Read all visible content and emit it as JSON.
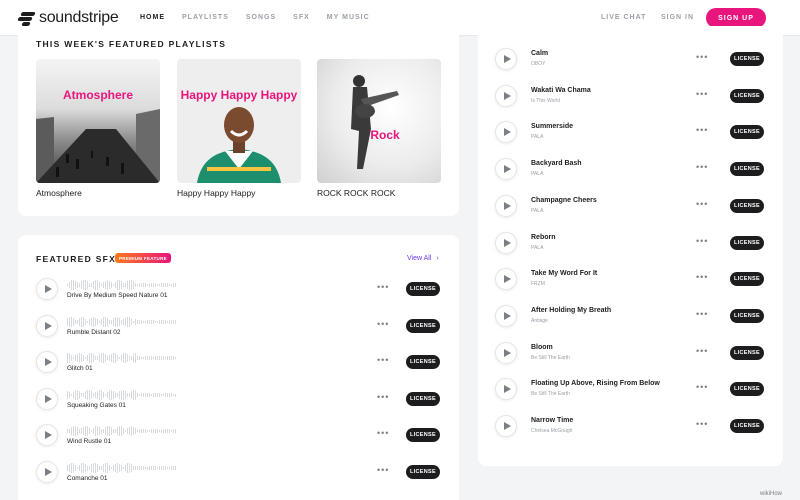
{
  "header": {
    "logo": "soundstripe",
    "nav": [
      "HOME",
      "PLAYLISTS",
      "SONGS",
      "SFX",
      "MY MUSIC"
    ],
    "live_chat": "LIVE CHAT",
    "sign_in": "SIGN IN",
    "sign_up": "SIGN UP",
    "accent": "#e8157d"
  },
  "playlists": {
    "title": "THIS WEEK'S FEATURED PLAYLISTS",
    "items": [
      {
        "overlay": "Atmosphere",
        "caption": "Atmosphere",
        "overlay_color": "#e8157d"
      },
      {
        "overlay": "Happy Happy Happy",
        "caption": "Happy Happy Happy",
        "overlay_color": "#e8157d"
      },
      {
        "overlay": "Rock",
        "caption": "ROCK ROCK ROCK",
        "overlay_color": "#e8157d"
      }
    ]
  },
  "sfx": {
    "title": "FEATURED SFX",
    "badge": "PREMIUM FEATURE",
    "view_all": "View All",
    "license_label": "LICENSE",
    "items": [
      "Drive By Medium Speed Nature 01",
      "Rumble Distant 02",
      "Glitch 01",
      "Squeaking Gates 01",
      "Wind Rustle 01",
      "Comanche 01"
    ]
  },
  "songs": {
    "license_label": "LICENSE",
    "items": [
      {
        "title": "Calm",
        "artist": "OBOY"
      },
      {
        "title": "Wakati Wa Chama",
        "artist": "Is This World"
      },
      {
        "title": "Summerside",
        "artist": "PALA"
      },
      {
        "title": "Backyard Bash",
        "artist": "PALA"
      },
      {
        "title": "Champagne Cheers",
        "artist": "PALA"
      },
      {
        "title": "Reborn",
        "artist": "PALA"
      },
      {
        "title": "Take My Word For It",
        "artist": "FRZM"
      },
      {
        "title": "After Holding My Breath",
        "artist": "Antiage"
      },
      {
        "title": "Bloom",
        "artist": "Be Still The Earth"
      },
      {
        "title": "Floating Up Above, Rising From Below",
        "artist": "Be Still The Earth"
      },
      {
        "title": "Narrow Time",
        "artist": "Chelsea McGough"
      }
    ]
  },
  "watermark": "wikiHow"
}
